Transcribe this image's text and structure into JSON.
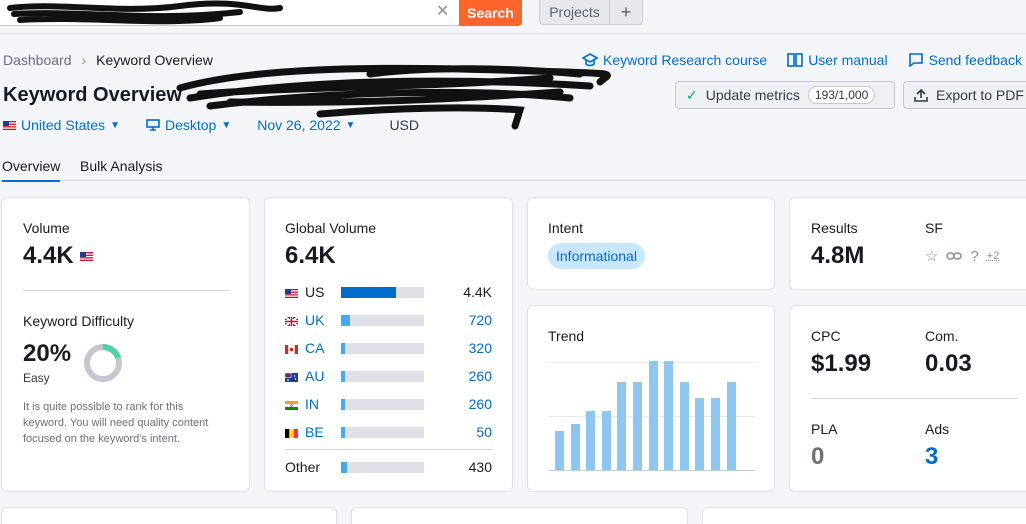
{
  "topbar": {
    "search_value": "",
    "search_button": "Search",
    "projects_button": "Projects",
    "plus_button": "+"
  },
  "breadcrumb": {
    "root": "Dashboard",
    "current": "Keyword Overview"
  },
  "links": {
    "course": "Keyword Research course",
    "manual": "User manual",
    "feedback": "Send feedback"
  },
  "header": {
    "title": "Keyword Overview",
    "update_label": "Update metrics",
    "update_quota": "193/1,000",
    "export_label": "Export to PDF"
  },
  "filters": {
    "country": "United States",
    "device": "Desktop",
    "date": "Nov 26, 2022",
    "currency": "USD"
  },
  "tabs": [
    "Overview",
    "Bulk Analysis"
  ],
  "volume_card": {
    "volume_label": "Volume",
    "volume_value": "4.4K",
    "kd_label": "Keyword Difficulty",
    "kd_value": "20%",
    "kd_percent": 20,
    "kd_level": "Easy",
    "kd_description": "It is quite possible to rank for this keyword. You will need quality content focused on the keyword’s intent."
  },
  "global_card": {
    "label": "Global Volume",
    "value": "6.4K",
    "rows": [
      {
        "code": "US",
        "value": "4.4K",
        "share": 0.66
      },
      {
        "code": "UK",
        "value": "720",
        "share": 0.11
      },
      {
        "code": "CA",
        "value": "320",
        "share": 0.05
      },
      {
        "code": "AU",
        "value": "260",
        "share": 0.04
      },
      {
        "code": "IN",
        "value": "260",
        "share": 0.04
      },
      {
        "code": "BE",
        "value": "50",
        "share": 0.02
      }
    ],
    "other_label": "Other",
    "other_value": "430",
    "other_share": 0.07
  },
  "intent_card": {
    "label": "Intent",
    "badge": "Informational"
  },
  "trend_card": {
    "label": "Trend"
  },
  "results_card": {
    "results_label": "Results",
    "results_value": "4.8M",
    "sf_label": "SF",
    "sf_more": "+2"
  },
  "cpc_card": {
    "cpc_label": "CPC",
    "cpc_value": "$1.99",
    "com_label": "Com.",
    "com_value": "0.03",
    "pla_label": "PLA",
    "pla_value": "0",
    "ads_label": "Ads",
    "ads_value": "3"
  },
  "colors": {
    "accent": "#006dca",
    "search": "#ff642d",
    "trend": "#8fc6ee",
    "kd_green": "#4fd3a5",
    "kd_track": "#c4c7cf",
    "intent_bg": "#c9e7fb"
  },
  "chart_data": {
    "type": "bar",
    "title": "Trend",
    "values": [
      0.36,
      0.42,
      0.54,
      0.54,
      0.81,
      0.81,
      1.0,
      1.0,
      0.81,
      0.66,
      0.66,
      0.81
    ],
    "ylim": [
      0,
      1
    ]
  }
}
